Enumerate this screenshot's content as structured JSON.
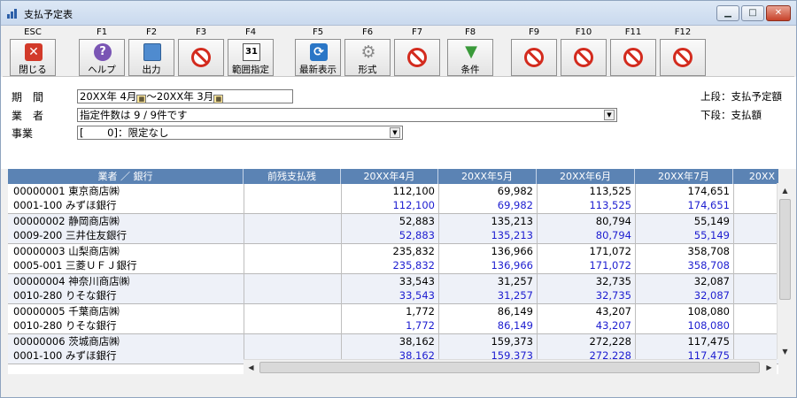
{
  "window": {
    "title": "支払予定表",
    "controls": {
      "minimize": "▁",
      "maximize": "□",
      "close": "✕"
    }
  },
  "toolbar": [
    {
      "key": "ESC",
      "label": "閉じる",
      "icon": "close-icon"
    },
    {
      "key": "F1",
      "label": "ヘルプ",
      "icon": "help-icon"
    },
    {
      "key": "F2",
      "label": "出力",
      "icon": "print-icon"
    },
    {
      "key": "F3",
      "label": "",
      "icon": "disabled-icon"
    },
    {
      "key": "F4",
      "label": "範囲指定",
      "icon": "calendar-icon",
      "icon_text": "31"
    },
    {
      "key": "F5",
      "label": "最新表示",
      "icon": "refresh-icon"
    },
    {
      "key": "F6",
      "label": "形式",
      "icon": "gear-icon"
    },
    {
      "key": "F7",
      "label": "",
      "icon": "disabled-icon"
    },
    {
      "key": "F8",
      "label": "条件",
      "icon": "filter-icon"
    },
    {
      "key": "F9",
      "label": "",
      "icon": "disabled-icon"
    },
    {
      "key": "F10",
      "label": "",
      "icon": "disabled-icon"
    },
    {
      "key": "F11",
      "label": "",
      "icon": "disabled-icon"
    },
    {
      "key": "F12",
      "label": "",
      "icon": "disabled-icon"
    }
  ],
  "form": {
    "period_label": "期　間",
    "period_from": "20XX年 4月",
    "period_sep": "～",
    "period_to": "20XX年 3月",
    "vendor_label": "業　者",
    "vendor_value": "指定件数は 9 / 9件です",
    "business_label": "事業",
    "business_value": "[　　 0]：限定なし",
    "note_top": "上段：支払予定額",
    "note_bottom": "下段：支払額"
  },
  "grid": {
    "headers": [
      "業者 ／ 銀行",
      "前残支払残",
      "20XX年4月",
      "20XX年5月",
      "20XX年6月",
      "20XX年7月",
      "20XX"
    ],
    "rows": [
      {
        "vendor": "00000001 東京商店㈱",
        "bank": "0001-100 みずほ銀行",
        "planned": [
          "112,100",
          "69,982",
          "113,525",
          "174,651"
        ],
        "paid": [
          "112,100",
          "69,982",
          "113,525",
          "174,651"
        ]
      },
      {
        "vendor": "00000002 静岡商店㈱",
        "bank": "0009-200 三井住友銀行",
        "planned": [
          "52,883",
          "135,213",
          "80,794",
          "55,149"
        ],
        "paid": [
          "52,883",
          "135,213",
          "80,794",
          "55,149"
        ]
      },
      {
        "vendor": "00000003 山梨商店㈱",
        "bank": "0005-001 三菱ＵＦＪ銀行",
        "planned": [
          "235,832",
          "136,966",
          "171,072",
          "358,708"
        ],
        "paid": [
          "235,832",
          "136,966",
          "171,072",
          "358,708"
        ]
      },
      {
        "vendor": "00000004 神奈川商店㈱",
        "bank": "0010-280 りそな銀行",
        "planned": [
          "33,543",
          "31,257",
          "32,735",
          "32,087"
        ],
        "paid": [
          "33,543",
          "31,257",
          "32,735",
          "32,087"
        ]
      },
      {
        "vendor": "00000005 千葉商店㈱",
        "bank": "0010-280 りそな銀行",
        "planned": [
          "1,772",
          "86,149",
          "43,207",
          "108,080"
        ],
        "paid": [
          "1,772",
          "86,149",
          "43,207",
          "108,080"
        ]
      },
      {
        "vendor": "00000006 茨城商店㈱",
        "bank": "0001-100 みずほ銀行",
        "planned": [
          "38,162",
          "159,373",
          "272,228",
          "117,475"
        ],
        "paid": [
          "38,162",
          "159,373",
          "272,228",
          "117,475"
        ]
      }
    ]
  },
  "scrollbars": {
    "up": "▲",
    "down": "▼",
    "left": "◀",
    "right": "▶"
  },
  "colors": {
    "header_bg": "#5b83b4",
    "paid_text": "#1d1dd0",
    "alt_row": "#eef1f8"
  }
}
